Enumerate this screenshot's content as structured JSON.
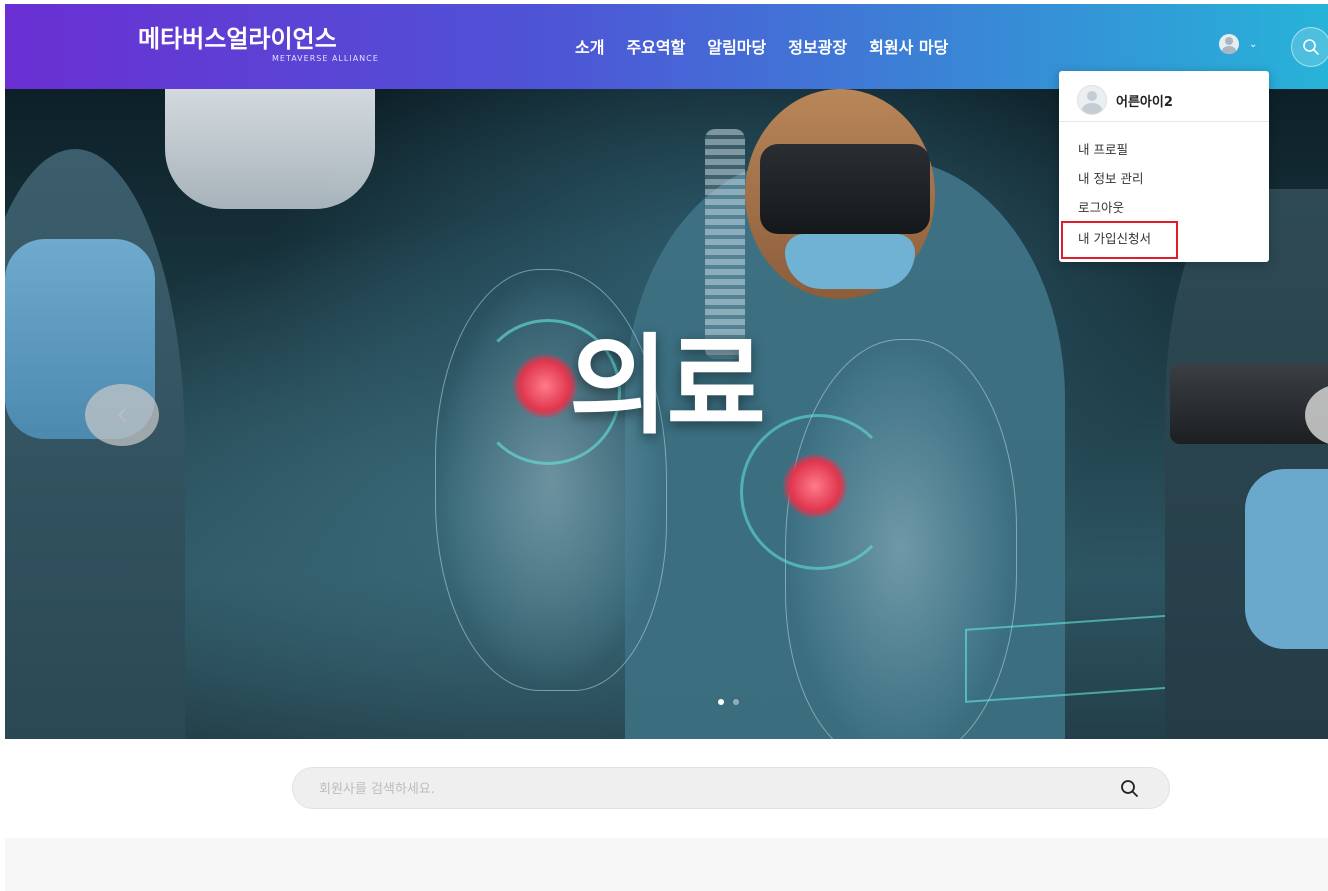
{
  "header": {
    "logo_title": "메타버스얼라이언스",
    "logo_subtitle": "METAVERSE ALLIANCE",
    "nav": [
      "소개",
      "주요역할",
      "알림마당",
      "정보광장",
      "회원사 마당"
    ],
    "user_chevron": "⌄",
    "search_icon": "search-icon"
  },
  "dropdown": {
    "username": "어른아이2",
    "items": [
      "내 프로필",
      "내 정보 관리",
      "로그아웃",
      "내 가입신청서"
    ],
    "highlighted_item": "내 가입신청서",
    "highlight_color": "#e01d2a"
  },
  "hero": {
    "title": "의료",
    "prev_icon": "chevron-left-icon",
    "slide_dots": 2,
    "active_slide": 1
  },
  "member_search": {
    "placeholder": "회원사를 검색하세요.",
    "value": "",
    "icon": "search-icon"
  },
  "colors": {
    "header_gradient_start": "#6a2fd3",
    "header_gradient_end": "#27b3d8",
    "accent_red": "#e01d2a"
  }
}
